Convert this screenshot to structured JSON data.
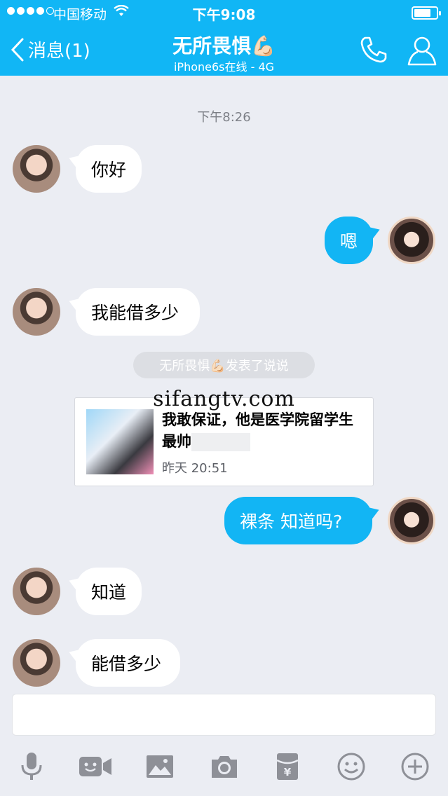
{
  "status_bar": {
    "carrier": "中国移动",
    "time": "下午9:08",
    "signal_bars": 4,
    "battery_level": 0.75
  },
  "nav": {
    "back_label": "消息(1)",
    "title": "无所畏惧💪🏻",
    "subtitle": "iPhone6s在线 - 4G",
    "call_icon": "phone-icon",
    "profile_icon": "profile-icon"
  },
  "chat": {
    "timestamp": "下午8:26",
    "messages": [
      {
        "side": "in",
        "text": "你好"
      },
      {
        "side": "out",
        "text": "嗯"
      },
      {
        "side": "in",
        "text": "我能借多少"
      },
      {
        "side": "out",
        "text": "裸条 知道吗?"
      },
      {
        "side": "in",
        "text": "知道"
      },
      {
        "side": "in",
        "text": "能借多少"
      }
    ],
    "system_note": "无所畏惧💪🏻发表了说说",
    "shared_post": {
      "text": "我敢保证，他是医学院留学生最帅",
      "time": "昨天 20:51"
    },
    "watermark": "sifangtv.com"
  },
  "input": {
    "placeholder": ""
  },
  "toolbar": {
    "icons": [
      "microphone-icon",
      "video-call-icon",
      "image-icon",
      "camera-icon",
      "red-packet-icon",
      "emoji-icon",
      "plus-icon"
    ]
  },
  "colors": {
    "accent": "#11b6f5",
    "background": "#ebedf3",
    "outgoing_bubble": "#12b5f4",
    "incoming_bubble": "#ffffff",
    "icon_gray": "#8e9097"
  }
}
